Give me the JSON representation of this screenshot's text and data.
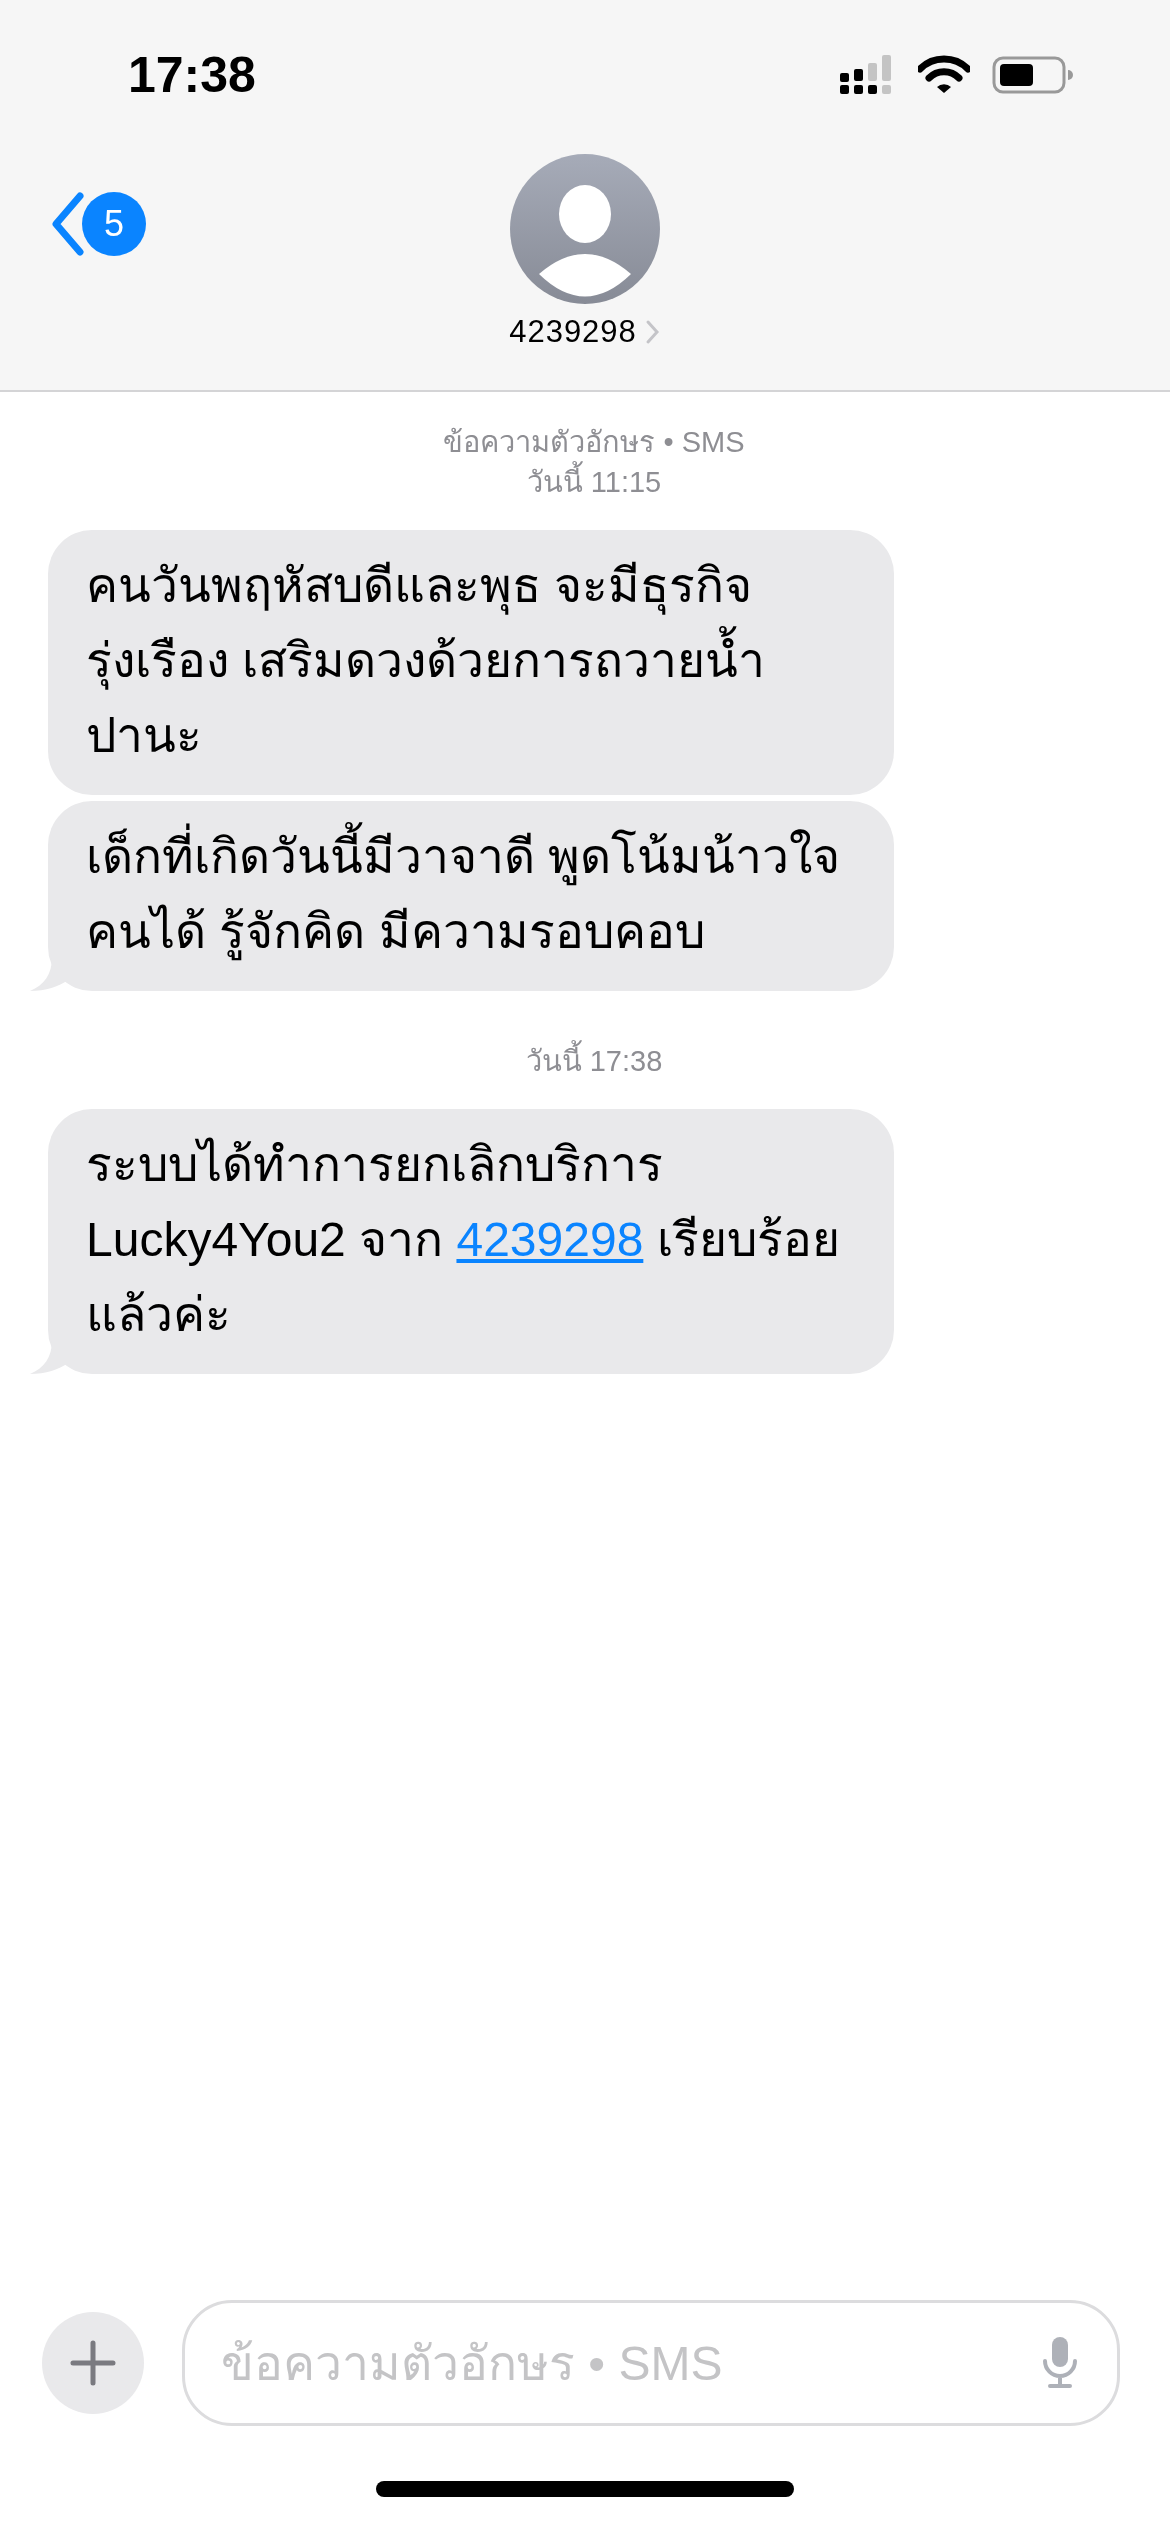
{
  "status_bar": {
    "time": "17:38"
  },
  "header": {
    "back_badge": "5",
    "contact": "4239298"
  },
  "groups": [
    {
      "service": "ข้อความตัวอักษร • SMS",
      "timestamp": "วันนี้ 11:15",
      "messages": [
        {
          "parts": [
            {
              "text": "คนวันพฤหัสบดีและพุธ จะมีธุรกิจรุ่งเรือง เสริมดวงด้วยการถวายน้ำปานะ"
            }
          ],
          "tail": false
        },
        {
          "parts": [
            {
              "text": "เด็กที่เกิดวันนี้มีวาจาดี พูดโน้มน้าวใจคนได้ รู้จักคิด มีความรอบคอบ"
            }
          ],
          "tail": true
        }
      ]
    },
    {
      "timestamp": "วันนี้ 17:38",
      "messages": [
        {
          "parts": [
            {
              "text": "ระบบได้ทำการยกเลิกบริการ Lucky4You2 จาก "
            },
            {
              "text": "4239298",
              "kind": "link"
            },
            {
              "text": " เรียบร้อยแล้วค่ะ"
            }
          ],
          "tail": true
        }
      ]
    }
  ],
  "composer": {
    "placeholder": "ข้อความตัวอักษร • SMS"
  }
}
